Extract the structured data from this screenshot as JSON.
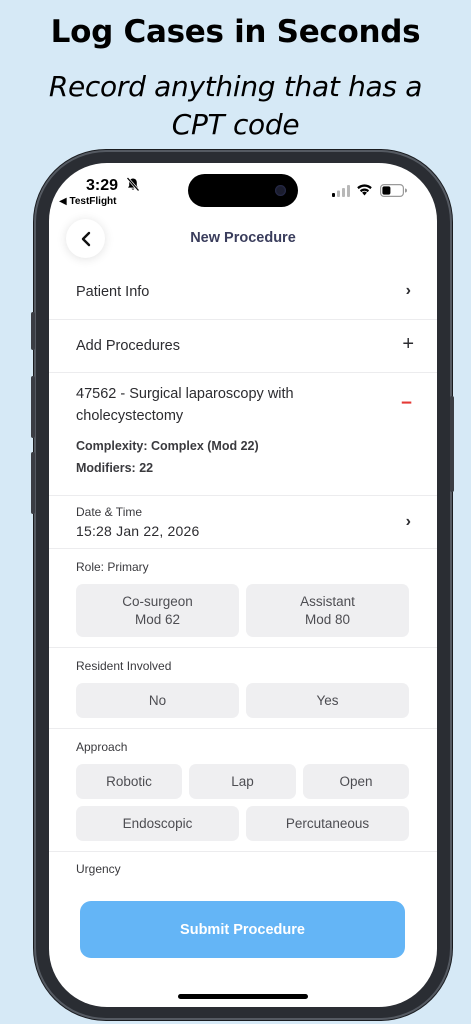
{
  "promo": {
    "title": "Log Cases in Seconds",
    "subtitle": "Record anything that has a CPT code"
  },
  "status_bar": {
    "time": "3:29",
    "back_app": "◀ TestFlight",
    "icons": [
      "bell-slash-icon",
      "signal-icon",
      "wifi-icon",
      "battery-icon"
    ]
  },
  "header": {
    "title": "New Procedure",
    "back_icon": "chevron-left-icon"
  },
  "patient_info": {
    "label": "Patient Info",
    "chevron": "›"
  },
  "add_procedures": {
    "label": "Add Procedures",
    "action": "+"
  },
  "procedure": {
    "title": "47562 - Surgical laparoscopy with cholecystectomy",
    "complexity": "Complexity: Complex (Mod 22)",
    "modifiers": "Modifiers: 22",
    "remove": "−"
  },
  "date_time": {
    "label": "Date & Time",
    "value": "15:28 Jan 22, 2026",
    "chevron": "›"
  },
  "role": {
    "label": "Role: Primary",
    "options": [
      {
        "line1": "Co-surgeon",
        "line2": "Mod 62"
      },
      {
        "line1": "Assistant",
        "line2": "Mod 80"
      }
    ]
  },
  "resident": {
    "label": "Resident Involved",
    "options": [
      "No",
      "Yes"
    ]
  },
  "approach": {
    "label": "Approach",
    "options": [
      "Robotic",
      "Lap",
      "Open",
      "Endoscopic",
      "Percutaneous"
    ]
  },
  "urgency": {
    "label": "Urgency"
  },
  "submit": {
    "label": "Submit Procedure"
  },
  "colors": {
    "background": "#d6e9f6",
    "accent": "#64b5f6",
    "remove": "#e53935",
    "option_bg": "#efeff1"
  }
}
